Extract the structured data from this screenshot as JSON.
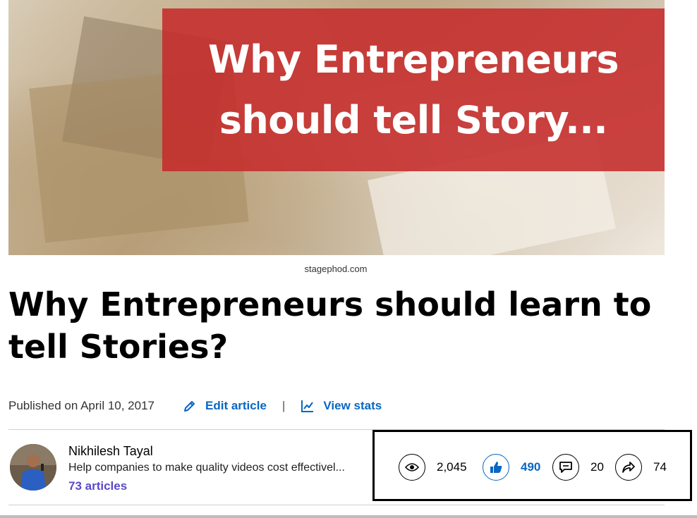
{
  "hero": {
    "banner_line1": "Why Entrepreneurs",
    "banner_line2": "should tell Story...",
    "caption": "stagephod.com"
  },
  "article": {
    "title": "Why Entrepreneurs should learn to tell Stories?",
    "published": "Published on April 10, 2017",
    "edit_label": "Edit article",
    "separator": "|",
    "stats_label": "View stats"
  },
  "author": {
    "name": "Nikhilesh Tayal",
    "headline": "Help companies to make quality videos cost effectivel...",
    "articles": "73 articles"
  },
  "stats": {
    "views": "2,045",
    "likes": "490",
    "comments": "20",
    "shares": "74"
  },
  "colors": {
    "accent": "#0a66c2",
    "banner": "#c52b2b",
    "articles_link": "#5a49c8"
  }
}
